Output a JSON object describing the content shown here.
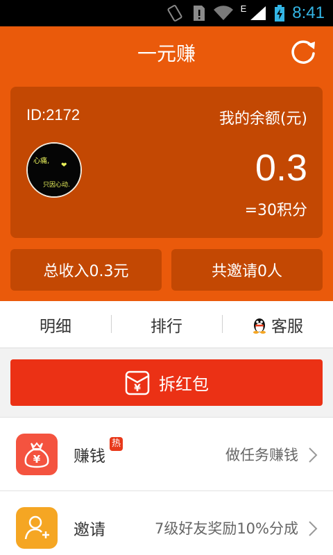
{
  "status_bar": {
    "time": "8:41",
    "network": "E"
  },
  "header": {
    "title": "一元赚"
  },
  "account": {
    "id_text": "ID:2172",
    "balance_label": "我的余额(元)",
    "balance": "0.3",
    "points_text": "=30积分",
    "avatar_text_1": "心痛,",
    "avatar_text_2": "只因心动."
  },
  "stats": {
    "income": "总收入0.3元",
    "invites": "共邀请0人"
  },
  "tabs": [
    {
      "label": "明细"
    },
    {
      "label": "排行"
    },
    {
      "label": "客服"
    }
  ],
  "red_packet": {
    "label": "拆红包"
  },
  "menu": [
    {
      "label": "赚钱",
      "badge": "热",
      "desc": "做任务赚钱",
      "icon": "money-bag-icon",
      "color": "#f4533f"
    },
    {
      "label": "邀请",
      "desc": "7级好友奖励10%分成",
      "icon": "add-user-icon",
      "color": "#f5a623"
    }
  ],
  "colors": {
    "primary": "#ea5a0b",
    "card": "#c34803",
    "red": "#eb3115"
  }
}
